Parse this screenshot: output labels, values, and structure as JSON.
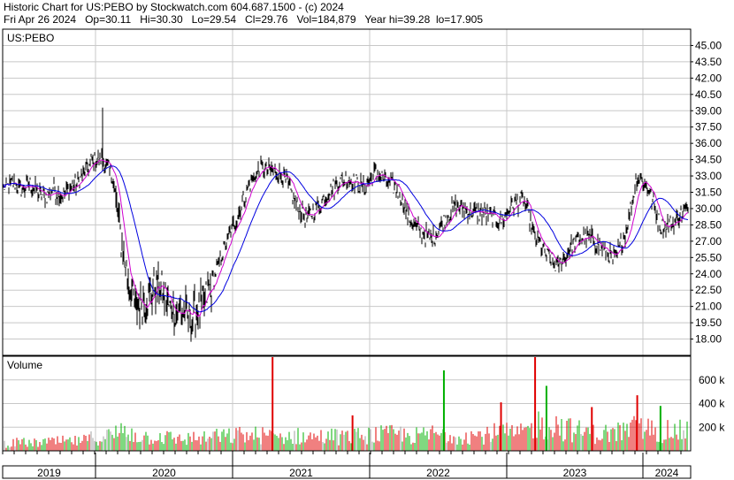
{
  "header": {
    "line1": "Historic Chart for US:PEBO by Stockwatch.com 604.687.1500 - (c) 2024",
    "date": "Fri Apr 26 2024",
    "open": "Op=30.11",
    "high": "Hi=30.30",
    "low": "Lo=29.54",
    "close": "Cl=29.76",
    "volume": "Vol=184,879",
    "year_range": "Year hi=39.28  lo=17.905"
  },
  "colors": {
    "price": "#000000",
    "ma_short": "#d000d0",
    "ma_long": "#0000e0",
    "vol_up": "#00b000",
    "vol_down": "#e00000",
    "vol_flat": "#a0a0a0",
    "grid": "#c8c8c8"
  },
  "chart_data": [
    {
      "type": "line",
      "title": "US:PEBO",
      "symbol": "US:PEBO",
      "grid": true,
      "ylim": [
        16.5,
        46.5
      ],
      "y_ticks": [
        "45.00",
        "43.50",
        "42.00",
        "40.50",
        "39.00",
        "37.50",
        "36.00",
        "34.50",
        "33.00",
        "31.50",
        "30.00",
        "28.50",
        "27.00",
        "25.50",
        "24.00",
        "22.50",
        "21.00",
        "19.50",
        "18.00"
      ],
      "x_tick_labels": [
        "2019",
        "2020",
        "2021",
        "2022",
        "2023",
        "2024"
      ],
      "series": [
        {
          "values": [
            {
              "x": "2019-01",
              "y": 32.0
            },
            {
              "x": "2019-02",
              "y": 32.3
            },
            {
              "x": "2019-03",
              "y": 31.7
            },
            {
              "x": "2019-04",
              "y": 32.3
            },
            {
              "x": "2019-05",
              "y": 31.5
            },
            {
              "x": "2019-06",
              "y": 31.0
            },
            {
              "x": "2019-07",
              "y": 31.8
            },
            {
              "x": "2019-08",
              "y": 31.2
            },
            {
              "x": "2019-09",
              "y": 31.8
            },
            {
              "x": "2019-10",
              "y": 32.2
            },
            {
              "x": "2019-11",
              "y": 33.2
            },
            {
              "x": "2019-12",
              "y": 34.3
            },
            {
              "x": "2020-01",
              "y": 34.6
            },
            {
              "x": "2020-02",
              "y": 33.0
            },
            {
              "x": "2020-03",
              "y": 25.0
            },
            {
              "x": "2020-04",
              "y": 21.0
            },
            {
              "x": "2020-05",
              "y": 21.8
            },
            {
              "x": "2020-06",
              "y": 23.2
            },
            {
              "x": "2020-07",
              "y": 20.8
            },
            {
              "x": "2020-08",
              "y": 20.5
            },
            {
              "x": "2020-09",
              "y": 20.0
            },
            {
              "x": "2020-10",
              "y": 21.3
            },
            {
              "x": "2020-11",
              "y": 24.0
            },
            {
              "x": "2020-12",
              "y": 27.0
            },
            {
              "x": "2021-01",
              "y": 29.5
            },
            {
              "x": "2021-02",
              "y": 32.3
            },
            {
              "x": "2021-03",
              "y": 33.8
            },
            {
              "x": "2021-04",
              "y": 33.5
            },
            {
              "x": "2021-05",
              "y": 33.0
            },
            {
              "x": "2021-06",
              "y": 30.5
            },
            {
              "x": "2021-07",
              "y": 29.0
            },
            {
              "x": "2021-08",
              "y": 30.3
            },
            {
              "x": "2021-09",
              "y": 31.6
            },
            {
              "x": "2021-10",
              "y": 32.6
            },
            {
              "x": "2021-11",
              "y": 32.7
            },
            {
              "x": "2021-12",
              "y": 31.9
            },
            {
              "x": "2022-01",
              "y": 33.3
            },
            {
              "x": "2022-02",
              "y": 32.5
            },
            {
              "x": "2022-03",
              "y": 31.7
            },
            {
              "x": "2022-04",
              "y": 29.0
            },
            {
              "x": "2022-05",
              "y": 27.8
            },
            {
              "x": "2022-06",
              "y": 27.2
            },
            {
              "x": "2022-07",
              "y": 28.8
            },
            {
              "x": "2022-08",
              "y": 30.3
            },
            {
              "x": "2022-09",
              "y": 29.8
            },
            {
              "x": "2022-10",
              "y": 29.6
            },
            {
              "x": "2022-11",
              "y": 29.4
            },
            {
              "x": "2022-12",
              "y": 28.8
            },
            {
              "x": "2023-01",
              "y": 30.3
            },
            {
              "x": "2023-02",
              "y": 30.8
            },
            {
              "x": "2023-03",
              "y": 27.3
            },
            {
              "x": "2023-04",
              "y": 25.8
            },
            {
              "x": "2023-05",
              "y": 24.6
            },
            {
              "x": "2023-06",
              "y": 26.2
            },
            {
              "x": "2023-07",
              "y": 27.3
            },
            {
              "x": "2023-08",
              "y": 27.2
            },
            {
              "x": "2023-09",
              "y": 26.2
            },
            {
              "x": "2023-10",
              "y": 25.3
            },
            {
              "x": "2023-11",
              "y": 27.8
            },
            {
              "x": "2023-12",
              "y": 33.0
            },
            {
              "x": "2024-01",
              "y": 31.8
            },
            {
              "x": "2024-02",
              "y": 28.4
            },
            {
              "x": "2024-03",
              "y": 28.6
            },
            {
              "x": "2024-04",
              "y": 29.76
            }
          ]
        }
      ]
    },
    {
      "type": "bar",
      "title": "Volume",
      "ylim": [
        0,
        800
      ],
      "y_ticks": [
        "600 k",
        "400 k",
        "200 k"
      ],
      "series": [
        {
          "values": [
            {
              "x": "2019-01",
              "y": 70
            },
            {
              "x": "2019-02",
              "y": 75
            },
            {
              "x": "2019-03",
              "y": 80
            },
            {
              "x": "2019-04",
              "y": 70
            },
            {
              "x": "2019-05",
              "y": 75
            },
            {
              "x": "2019-06",
              "y": 85
            },
            {
              "x": "2019-07",
              "y": 80
            },
            {
              "x": "2019-08",
              "y": 90
            },
            {
              "x": "2019-09",
              "y": 85
            },
            {
              "x": "2019-10",
              "y": 90
            },
            {
              "x": "2019-11",
              "y": 95
            },
            {
              "x": "2019-12",
              "y": 120
            },
            {
              "x": "2020-01",
              "y": 130
            },
            {
              "x": "2020-02",
              "y": 150
            },
            {
              "x": "2020-03",
              "y": 190
            },
            {
              "x": "2020-04",
              "y": 150
            },
            {
              "x": "2020-05",
              "y": 130
            },
            {
              "x": "2020-06",
              "y": 140
            },
            {
              "x": "2020-07",
              "y": 120
            },
            {
              "x": "2020-08",
              "y": 110
            },
            {
              "x": "2020-09",
              "y": 120
            },
            {
              "x": "2020-10",
              "y": 115
            },
            {
              "x": "2020-11",
              "y": 140
            },
            {
              "x": "2020-12",
              "y": 130
            },
            {
              "x": "2021-01",
              "y": 150
            },
            {
              "x": "2021-02",
              "y": 140
            },
            {
              "x": "2021-03",
              "y": 150
            },
            {
              "x": "2021-04",
              "y": 130
            },
            {
              "x": "2021-05",
              "y": 130
            },
            {
              "x": "2021-06",
              "y": 140
            },
            {
              "x": "2021-07",
              "y": 130
            },
            {
              "x": "2021-08",
              "y": 130
            },
            {
              "x": "2021-09",
              "y": 140
            },
            {
              "x": "2021-10",
              "y": 130
            },
            {
              "x": "2021-11",
              "y": 130
            },
            {
              "x": "2021-12",
              "y": 150
            },
            {
              "x": "2022-01",
              "y": 150
            },
            {
              "x": "2022-02",
              "y": 150
            },
            {
              "x": "2022-03",
              "y": 160
            },
            {
              "x": "2022-04",
              "y": 140
            },
            {
              "x": "2022-05",
              "y": 140
            },
            {
              "x": "2022-06",
              "y": 160
            },
            {
              "x": "2022-07",
              "y": 150
            },
            {
              "x": "2022-08",
              "y": 150
            },
            {
              "x": "2022-09",
              "y": 150
            },
            {
              "x": "2022-10",
              "y": 140
            },
            {
              "x": "2022-11",
              "y": 160
            },
            {
              "x": "2022-12",
              "y": 170
            },
            {
              "x": "2023-01",
              "y": 160
            },
            {
              "x": "2023-02",
              "y": 160
            },
            {
              "x": "2023-03",
              "y": 260
            },
            {
              "x": "2023-04",
              "y": 230
            },
            {
              "x": "2023-05",
              "y": 240
            },
            {
              "x": "2023-06",
              "y": 200
            },
            {
              "x": "2023-07",
              "y": 180
            },
            {
              "x": "2023-08",
              "y": 160
            },
            {
              "x": "2023-09",
              "y": 160
            },
            {
              "x": "2023-10",
              "y": 170
            },
            {
              "x": "2023-11",
              "y": 190
            },
            {
              "x": "2023-12",
              "y": 220
            },
            {
              "x": "2024-01",
              "y": 200
            },
            {
              "x": "2024-02",
              "y": 180
            },
            {
              "x": "2024-03",
              "y": 180
            },
            {
              "x": "2024-04",
              "y": 185
            }
          ]
        }
      ],
      "spikes": [
        {
          "x": "2021-04",
          "y": 810
        },
        {
          "x": "2021-11",
          "y": 300
        },
        {
          "x": "2022-07",
          "y": 680
        },
        {
          "x": "2022-12",
          "y": 410
        },
        {
          "x": "2023-03",
          "y": 810
        },
        {
          "x": "2023-04",
          "y": 550
        },
        {
          "x": "2023-08",
          "y": 370
        },
        {
          "x": "2023-12",
          "y": 470
        },
        {
          "x": "2024-02",
          "y": 380
        }
      ]
    }
  ]
}
